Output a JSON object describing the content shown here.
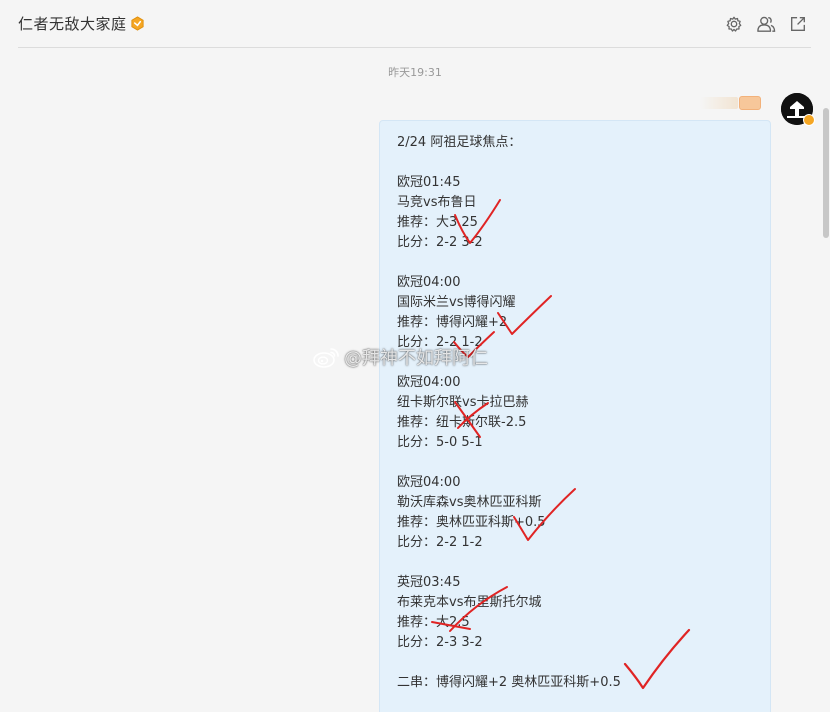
{
  "header": {
    "title": "仁者无敌大家庭",
    "badge_icon": "group-badge-icon",
    "actions": [
      {
        "name": "settings-icon"
      },
      {
        "name": "group-members-icon"
      },
      {
        "name": "popout-icon"
      }
    ]
  },
  "chat": {
    "timestamp": "昨天19:31",
    "message": {
      "lines": [
        "2/24 阿祖足球焦点：",
        "",
        "欧冠01:45",
        "马竞vs布鲁日",
        "推荐：大3.25",
        "比分：2-2 3-2",
        "",
        "欧冠04:00",
        "国际米兰vs博得闪耀",
        "推荐：博得闪耀+2",
        "比分：2-2 1-2",
        "",
        "欧冠04:00",
        "纽卡斯尔联vs卡拉巴赫",
        "推荐：纽卡斯尔联-2.5",
        "比分：5-0 5-1",
        "",
        "欧冠04:00",
        "勒沃库森vs奥林匹亚科斯",
        "推荐：奥林匹亚科斯+0.5",
        "比分：2-2 1-2",
        "",
        "英冠03:45",
        "布莱克本vs布里斯托尔城",
        "推荐：大2.5",
        "比分：2-3 3-2",
        "",
        "二串：博得闪耀+2 奥林匹亚科斯+0.5"
      ]
    }
  },
  "watermark": {
    "text": "@拜神不如拜阿仁"
  },
  "colors": {
    "bubble": "#e4f1fb",
    "check_mark": "#e02424",
    "background": "#f5f5f5"
  }
}
